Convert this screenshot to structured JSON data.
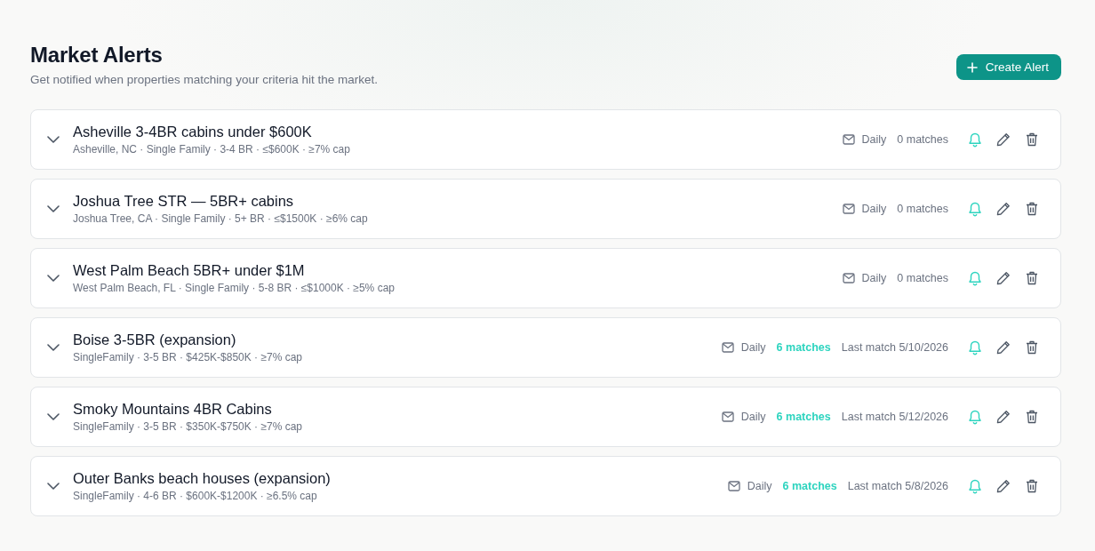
{
  "header": {
    "title": "Market Alerts",
    "subtitle": "Get notified when properties matching your criteria hit the market.",
    "create_button": "Create Alert"
  },
  "alerts": [
    {
      "name": "Asheville 3-4BR cabins under $600K",
      "criteria": "Asheville, NC · Single Family · 3-4 BR · ≤$600K · ≥7% cap",
      "frequency": "Daily",
      "matches": "0 matches",
      "has_matches": false,
      "notifications_on": true
    },
    {
      "name": "Joshua Tree STR — 5BR+ cabins",
      "criteria": "Joshua Tree, CA · Single Family · 5+ BR · ≤$1500K · ≥6% cap",
      "frequency": "Daily",
      "matches": "0 matches",
      "has_matches": false,
      "notifications_on": true
    },
    {
      "name": "West Palm Beach 5BR+ under $1M",
      "criteria": "West Palm Beach, FL · Single Family · 5-8 BR · ≤$1000K · ≥5% cap",
      "frequency": "Daily",
      "matches": "0 matches",
      "has_matches": false,
      "notifications_on": true
    },
    {
      "name": "Boise 3-5BR (expansion)",
      "criteria": "SingleFamily · 3-5 BR · $425K-$850K · ≥7% cap",
      "frequency": "Daily",
      "matches": "6 matches",
      "has_matches": true,
      "last_match": "Last match 5/10/2026",
      "notifications_on": true
    },
    {
      "name": "Smoky Mountains 4BR Cabins",
      "criteria": "SingleFamily · 3-5 BR · $350K-$750K · ≥7% cap",
      "frequency": "Daily",
      "matches": "6 matches",
      "has_matches": true,
      "last_match": "Last match 5/12/2026",
      "notifications_on": true
    },
    {
      "name": "Outer Banks beach houses (expansion)",
      "criteria": "SingleFamily · 4-6 BR · $600K-$1200K · ≥6.5% cap",
      "frequency": "Daily",
      "matches": "6 matches",
      "has_matches": true,
      "last_match": "Last match 5/8/2026",
      "notifications_on": true
    }
  ]
}
